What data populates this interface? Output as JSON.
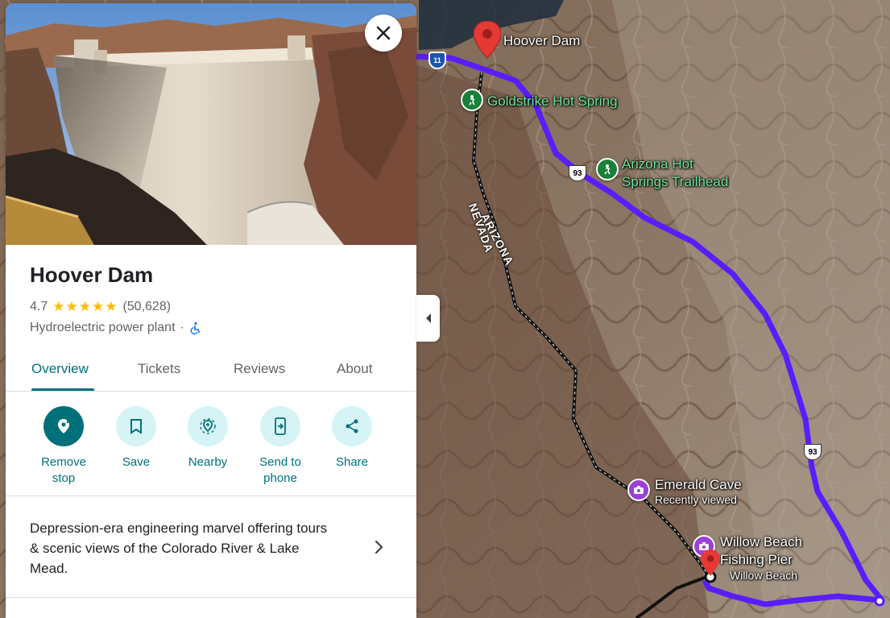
{
  "place": {
    "name": "Hoover Dam",
    "rating": "4.7",
    "stars": "★★★★★",
    "review_count": "(50,628)",
    "category": "Hydroelectric power plant",
    "separator": "·"
  },
  "tabs": [
    {
      "label": "Overview"
    },
    {
      "label": "Tickets"
    },
    {
      "label": "Reviews"
    },
    {
      "label": "About"
    }
  ],
  "actions": [
    {
      "label": "Remove stop",
      "icon": "remove-stop-icon"
    },
    {
      "label": "Save",
      "icon": "bookmark-icon"
    },
    {
      "label": "Nearby",
      "icon": "nearby-icon"
    },
    {
      "label": "Send to phone",
      "icon": "send-to-phone-icon"
    },
    {
      "label": "Share",
      "icon": "share-icon"
    }
  ],
  "description": "Depression-era engineering marvel offering tours & scenic views of the Colorado River & Lake Mead.",
  "map": {
    "labels": {
      "hoover_dam": "Hoover Dam",
      "goldstrike": "Goldstrike Hot Spring",
      "arizona_hot_springs": "Arizona Hot Springs Trailhead",
      "arizona_hot_springs_1": "Arizona Hot",
      "arizona_hot_springs_2": "Springs Trailhead",
      "arizona": "ARIZONA",
      "nevada": "NEVADA",
      "emerald_cave": "Emerald Cave",
      "recently_viewed": "Recently viewed",
      "willow_beach_pier_1": "Willow Beach",
      "willow_beach_pier_2": "Fishing Pier",
      "willow_beach": "Willow Beach"
    },
    "shields": {
      "us93": "93",
      "interstate": "11"
    }
  },
  "colors": {
    "accent": "#00707a",
    "route": "#5a1dff",
    "star": "#fbbc04",
    "pin_red": "#e53935"
  }
}
